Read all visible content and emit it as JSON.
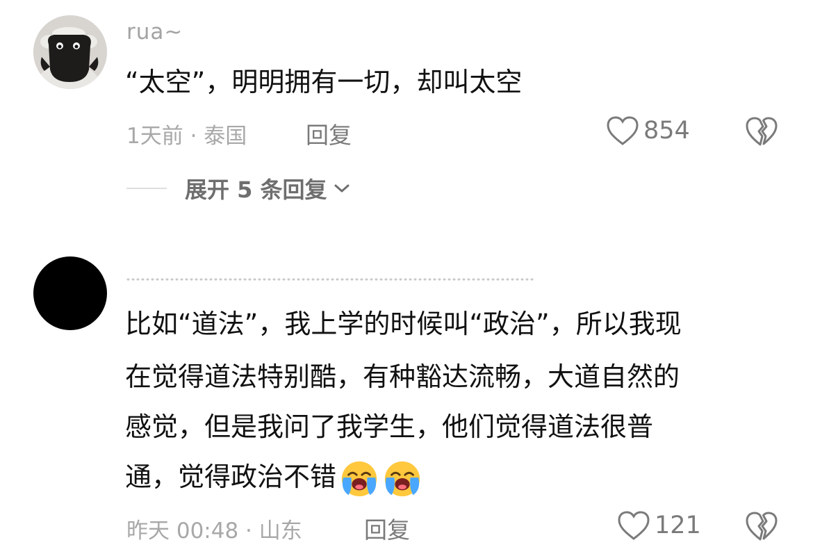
{
  "comments": [
    {
      "username": "rua~",
      "text": "“太空”，明明拥有一切，却叫太空",
      "time_location": "1天前 · 泰国",
      "reply_label": "回复",
      "likes": "854",
      "expand_label": "展开 5 条回复"
    },
    {
      "text_lines": [
        "比如“道法”，我上学的时候叫“政治”，所以我现",
        "在觉得道法特别酷，有种豁达流畅，大道自然的",
        "感觉，但是我问了我学生，他们觉得道法很普",
        "通，觉得政治不错"
      ],
      "emoji": [
        "loudly-crying-face",
        "loudly-crying-face"
      ],
      "time_location": "昨天 00:48 · 山东",
      "reply_label": "回复",
      "likes": "121"
    }
  ],
  "colors": {
    "text": "#111111",
    "meta": "#a8a8a8",
    "secondary": "#7a7a7a"
  }
}
